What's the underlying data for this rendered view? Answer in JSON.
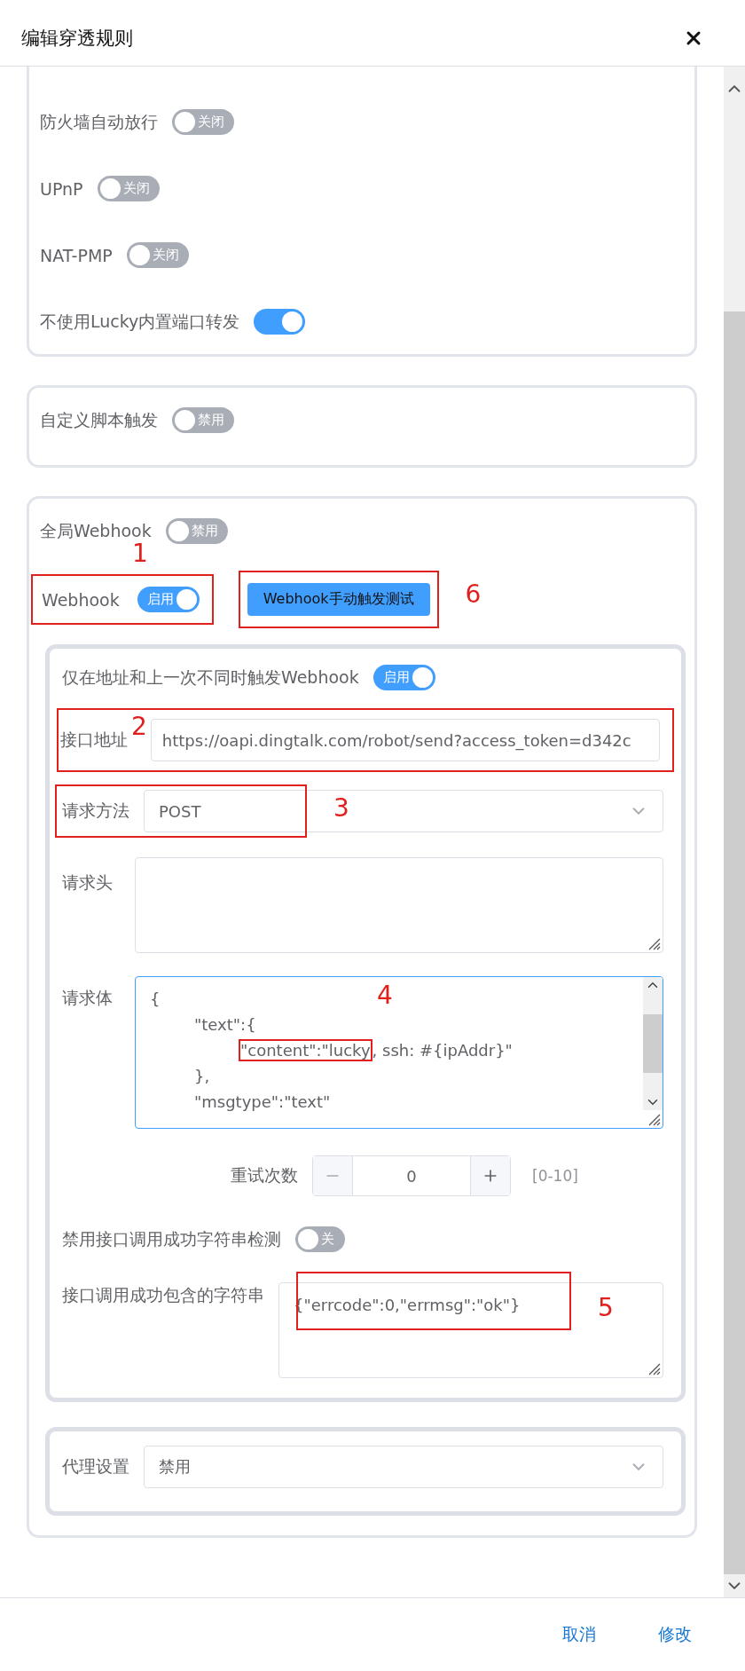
{
  "dialog": {
    "title": "编辑穿透规则"
  },
  "rule_options": [
    {
      "label": "防火墙自动放行",
      "on": false,
      "switch_text": "关闭"
    },
    {
      "label": "UPnP",
      "on": false,
      "switch_text": "关闭"
    },
    {
      "label": "NAT-PMP",
      "on": false,
      "switch_text": "关闭"
    },
    {
      "label": "不使用Lucky内置端口转发",
      "on": true
    }
  ],
  "script_trigger": {
    "label": "自定义脚本触发",
    "on": false,
    "switch_text": "禁用"
  },
  "webhook": {
    "global": {
      "label": "全局Webhook",
      "on": false,
      "switch_text": "禁用"
    },
    "enabled": {
      "label": "Webhook",
      "on": true,
      "switch_text": "启用",
      "annotation": "1"
    },
    "test_button": {
      "label": "Webhook手动触发测试",
      "annotation": "6"
    },
    "only_on_change": {
      "label": "仅在地址和上一次不同时触发Webhook",
      "on": true,
      "switch_text": "启用"
    },
    "url": {
      "label": "接口地址",
      "value": "https://oapi.dingtalk.com/robot/send?access_token=d342c",
      "annotation": "2"
    },
    "method": {
      "label": "请求方法",
      "value": "POST",
      "annotation": "3"
    },
    "headers": {
      "label": "请求头"
    },
    "body": {
      "label": "请求体",
      "annotation": "4",
      "lines": [
        {
          "text": "{"
        },
        {
          "children": [
            {
              "text": "\"text\":{"
            },
            {
              "children": [
                {
                  "text": "\"content\":\"lucky",
                  "after": ", ssh: #{ipAddr}\"",
                  "annotated": true
                }
              ]
            },
            {
              "text": "},"
            },
            {
              "text": "\"msgtype\":\"text\""
            }
          ]
        }
      ]
    },
    "retry": {
      "label": "重试次数",
      "value": "0",
      "range": "[0-10]"
    },
    "disable_check": {
      "label": "禁用接口调用成功字符串检测",
      "on": false,
      "switch_text": "关"
    },
    "success_string": {
      "label": "接口调用成功包含的字符串",
      "value": "{\"errcode\":0,\"errmsg\":\"ok\"}",
      "annotation": "5"
    },
    "proxy": {
      "label": "代理设置",
      "value": "禁用"
    }
  },
  "footer": {
    "buttons": [
      "取消",
      "修改"
    ]
  }
}
